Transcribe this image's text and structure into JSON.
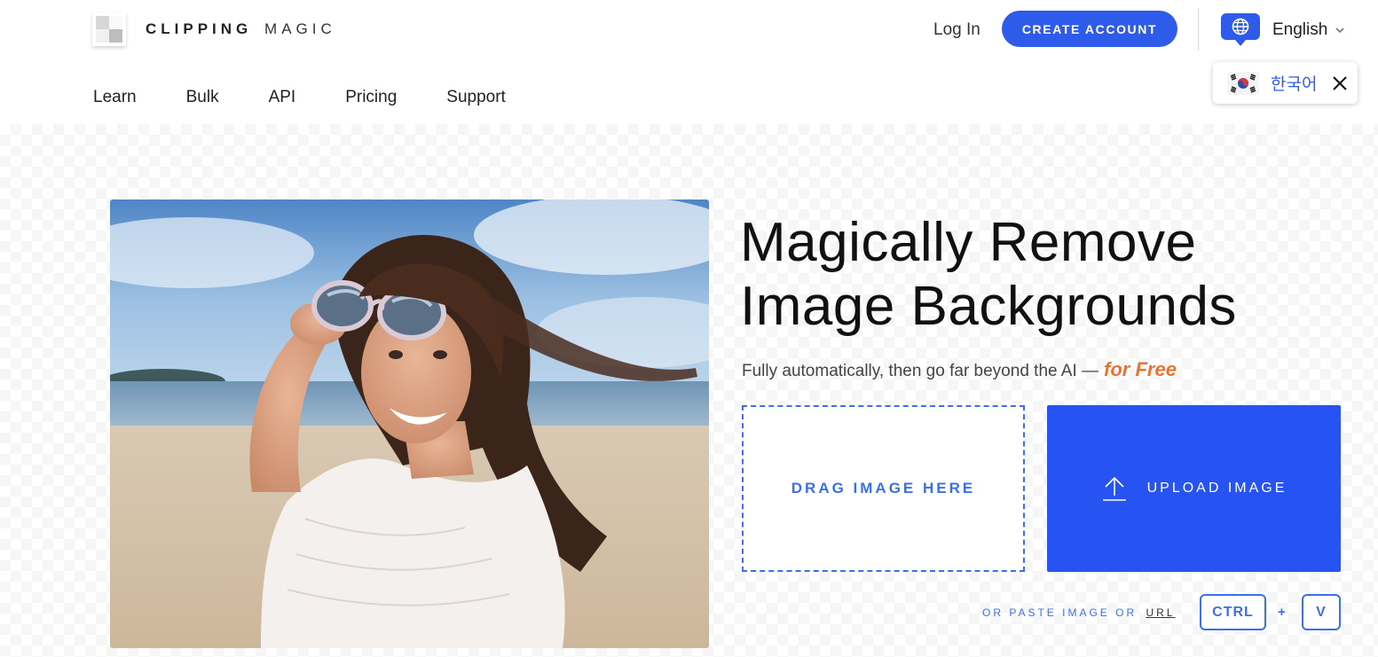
{
  "header": {
    "logo_bold": "CLIPPING",
    "logo_light": "MAGIC",
    "login_label": "Log In",
    "create_account_label": "CREATE ACCOUNT",
    "language_label": "English"
  },
  "language_popup": {
    "language_label": "한국어"
  },
  "nav": {
    "items": [
      {
        "label": "Learn"
      },
      {
        "label": "Bulk"
      },
      {
        "label": "API"
      },
      {
        "label": "Pricing"
      },
      {
        "label": "Support"
      }
    ]
  },
  "hero": {
    "headline_line1": "Magically Remove",
    "headline_line2": "Image Backgrounds",
    "subtitle": "Fully automatically, then go far beyond the AI —",
    "subtitle_highlight": "for Free",
    "drop_label": "DRAG IMAGE HERE",
    "upload_label": "UPLOAD IMAGE",
    "paste_text": "OR PASTE IMAGE OR",
    "url_label": "URL",
    "key_ctrl": "CTRL",
    "key_plus": "+",
    "key_v": "V"
  },
  "colors": {
    "accent": "#2f5bea",
    "upload_blue": "#2653f2",
    "free_orange": "#e8752f"
  }
}
